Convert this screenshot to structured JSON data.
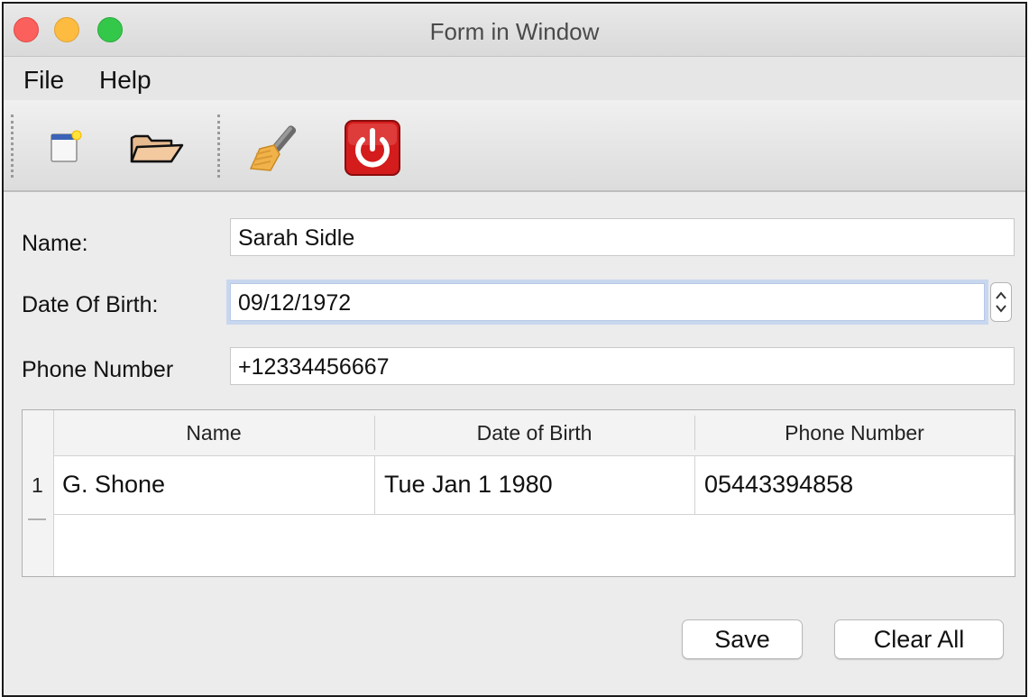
{
  "window": {
    "title": "Form in Window"
  },
  "menu": {
    "items": [
      "File",
      "Help"
    ]
  },
  "toolbar": {
    "tools": [
      "new-document-icon",
      "open-folder-icon",
      "broom-icon",
      "power-icon"
    ]
  },
  "form": {
    "name_label": "Name:",
    "name_value": "Sarah Sidle",
    "dob_label": "Date Of Birth:",
    "dob_value": "09/12/1972",
    "phone_label": "Phone Number",
    "phone_value": "+12334456667"
  },
  "table": {
    "headers": [
      "Name",
      "Date of Birth",
      "Phone Number"
    ],
    "rows": [
      {
        "index": "1",
        "cells": [
          "G. Shone",
          "Tue Jan 1 1980",
          "05443394858"
        ]
      }
    ]
  },
  "buttons": {
    "save": "Save",
    "clear_all": "Clear All"
  },
  "colors": {
    "close": "#fc605c",
    "minimize": "#fdbc40",
    "maximize": "#34c84a",
    "power_red": "#d41c1c",
    "focus_ring": "#c8d7ee"
  }
}
